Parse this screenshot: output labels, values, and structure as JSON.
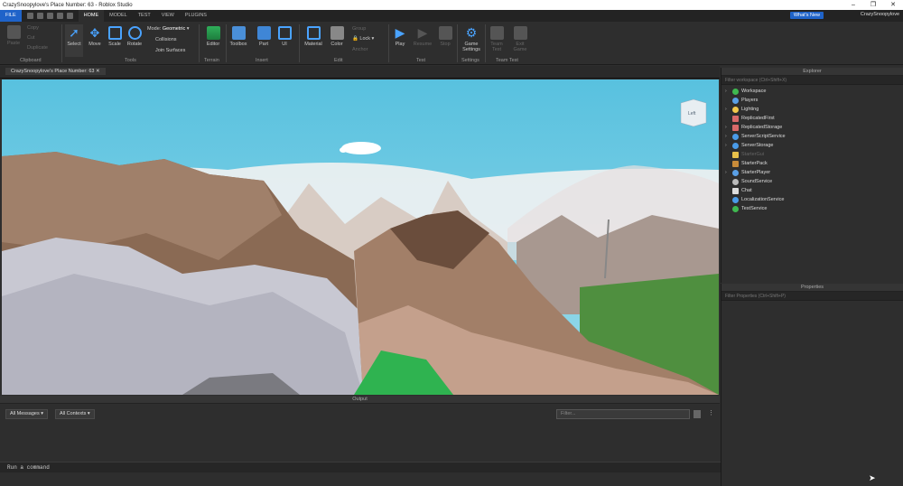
{
  "window": {
    "title": "CrazySnoopylove's Place Number: 63 - Roblox Studio"
  },
  "menu": {
    "file": "FILE",
    "tabs": [
      "HOME",
      "MODEL",
      "TEST",
      "VIEW",
      "PLUGINS"
    ],
    "whats_new": "What's New",
    "user": "CrazySnoopylove"
  },
  "ribbon": {
    "clipboard": {
      "paste": "Paste",
      "copy": "Copy",
      "cut": "Cut",
      "duplicate": "Duplicate",
      "group": "Clipboard"
    },
    "tools": {
      "select": "Select",
      "move": "Move",
      "scale": "Scale",
      "rotate": "Rotate",
      "mode_label": "Mode:",
      "mode_value": "Geometric",
      "collisions": "Collisions",
      "join_surfaces": "Join Surfaces",
      "group": "Tools"
    },
    "terrain": {
      "editor": "Editor",
      "group": "Terrain"
    },
    "insert": {
      "toolbox": "Toolbox",
      "part": "Part",
      "ui": "UI",
      "group": "Insert"
    },
    "edit": {
      "material": "Material",
      "color": "Color",
      "group_btn": "Group",
      "lock": "Lock",
      "anchor": "Anchor",
      "group": "Edit"
    },
    "test": {
      "play": "Play",
      "resume": "Resume",
      "stop": "Stop",
      "group": "Test"
    },
    "settings": {
      "game_settings": "Game Settings",
      "group": "Settings"
    },
    "team_test": {
      "team_test": "Team Test",
      "exit_game": "Exit Game",
      "group": "Team Test"
    }
  },
  "doc_tab": "CrazySnoopylove's Place Number: 63",
  "viewport": {
    "view_cube_face": "Left"
  },
  "output": {
    "title": "Output",
    "messages_dropdown": "All Messages",
    "contexts_dropdown": "All Contexts",
    "filter_placeholder": "Filter..."
  },
  "command_bar": {
    "placeholder": "Run a command"
  },
  "explorer": {
    "title": "Explorer",
    "filter_placeholder": "Filter workspace (Ctrl+Shift+X)",
    "items": [
      {
        "label": "Workspace",
        "icon": "globe-icon",
        "color": "#3fb950"
      },
      {
        "label": "Players",
        "icon": "players-icon",
        "color": "#5aa0e6"
      },
      {
        "label": "Lighting",
        "icon": "lightbulb-icon",
        "color": "#f2c94c"
      },
      {
        "label": "ReplicatedFirst",
        "icon": "folder-icon",
        "color": "#d96a6a"
      },
      {
        "label": "ReplicatedStorage",
        "icon": "folder-icon",
        "color": "#d96a6a"
      },
      {
        "label": "ServerScriptService",
        "icon": "script-service-icon",
        "color": "#4a9be8"
      },
      {
        "label": "ServerStorage",
        "icon": "storage-icon",
        "color": "#4a9be8"
      },
      {
        "label": "StarterGui",
        "icon": "gui-icon",
        "color": "#e8c14a"
      },
      {
        "label": "StarterPack",
        "icon": "backpack-icon",
        "color": "#c88b3a"
      },
      {
        "label": "StarterPlayer",
        "icon": "player-icon",
        "color": "#5aa0e6"
      },
      {
        "label": "SoundService",
        "icon": "sound-icon",
        "color": "#bbbbbb"
      },
      {
        "label": "Chat",
        "icon": "chat-icon",
        "color": "#dddddd"
      },
      {
        "label": "LocalizationService",
        "icon": "localization-icon",
        "color": "#4a9be8"
      },
      {
        "label": "TestService",
        "icon": "test-icon",
        "color": "#3fb950"
      }
    ]
  },
  "properties": {
    "title": "Properties",
    "filter_placeholder": "Filter Properties (Ctrl+Shift+P)"
  }
}
